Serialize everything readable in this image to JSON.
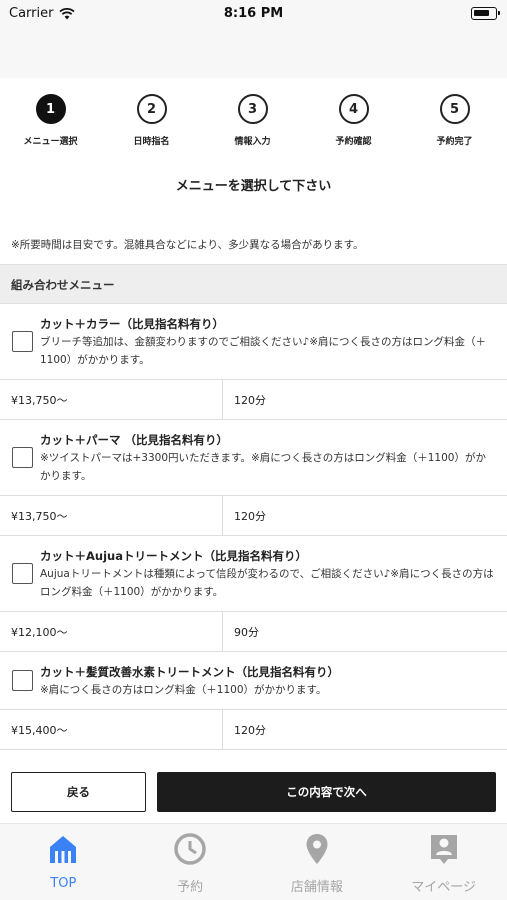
{
  "status_bar": {
    "carrier": "Carrier",
    "time": "8:16 PM"
  },
  "steps": [
    {
      "number": "1",
      "label": "メニュー選択",
      "active": true
    },
    {
      "number": "2",
      "label": "日時指名",
      "active": false
    },
    {
      "number": "3",
      "label": "情報入力",
      "active": false
    },
    {
      "number": "4",
      "label": "予約確認",
      "active": false
    },
    {
      "number": "5",
      "label": "予約完了",
      "active": false
    }
  ],
  "heading": "メニューを選択して下さい",
  "notice": "※所要時間は目安です。混雑具合などにより、多少異なる場合があります。",
  "section_title": "組み合わせメニュー",
  "menus": [
    {
      "name": "カット＋カラー（比見指名料有り）",
      "note": "ブリーチ等追加は、金額変わりますのでご相談ください♪※肩につく長さの方はロング料金（＋1100）がかかります。",
      "price": "¥13,750〜",
      "duration": "120分"
    },
    {
      "name": "カット＋パーマ （比見指名料有り）",
      "note": "※ツイストパーマは+3300円いただきます。※肩につく長さの方はロング料金（＋1100）がかかります。",
      "price": "¥13,750〜",
      "duration": "120分"
    },
    {
      "name": "カット＋Aujuaトリートメント（比見指名料有り）",
      "note": "Aujuaトリートメントは種類によって信段が変わるので、ご相談ください♪※肩につく長さの方はロング料金（＋1100）がかかります。",
      "price": "¥12,100〜",
      "duration": "90分"
    },
    {
      "name": "カット＋髪質改善水素トリートメント（比見指名料有り）",
      "note": "※肩につく長さの方はロング料金（＋1100）がかかります。",
      "price": "¥15,400〜",
      "duration": "120分"
    }
  ],
  "buttons": {
    "back": "戻る",
    "next": "この内容で次へ"
  },
  "tabs": [
    {
      "label": "TOP",
      "icon": "home-icon",
      "active": true
    },
    {
      "label": "予約",
      "icon": "clock-icon",
      "active": false
    },
    {
      "label": "店舗情報",
      "icon": "location-pin-icon",
      "active": false
    },
    {
      "label": "マイページ",
      "icon": "account-icon",
      "active": false
    }
  ],
  "colors": {
    "accent": "#3b82f6",
    "inactive": "#a6a6a6",
    "primary_button": "#1c1c1c"
  }
}
